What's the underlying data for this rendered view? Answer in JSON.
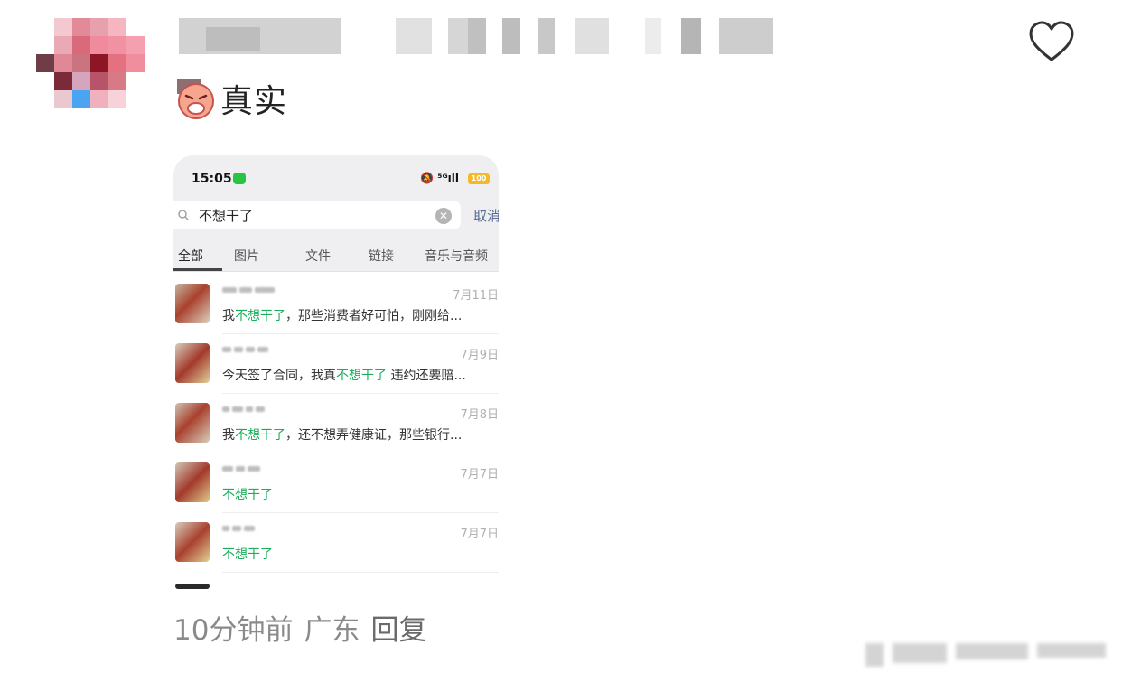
{
  "comment": {
    "text": "真实",
    "emoji_icon": "weary-face-icon"
  },
  "screenshot": {
    "status_time": "15:05",
    "status_icons": "🔕 ⁵ᴳıll",
    "battery": "100",
    "search": {
      "value": "不想干了",
      "cancel": "取消"
    },
    "tabs": [
      "全部",
      "图片",
      "文件",
      "链接",
      "音乐与音频"
    ],
    "results": [
      {
        "date": "7月11日",
        "pre": "我",
        "hl": "不想干了",
        "post": "，那些消费者好可怕，刚刚给..."
      },
      {
        "date": "7月9日",
        "pre": "今天签了合同，我真",
        "hl": "不想干了",
        "post": " 违约还要赔..."
      },
      {
        "date": "7月8日",
        "pre": "我",
        "hl": "不想干了",
        "post": "，还不想弄健康证，那些银行..."
      },
      {
        "date": "7月7日",
        "pre": "",
        "hl": "不想干了",
        "post": ""
      },
      {
        "date": "7月7日",
        "pre": "",
        "hl": "不想干了",
        "post": ""
      }
    ]
  },
  "footer": {
    "time": "10分钟前",
    "location": "广东",
    "reply": "回复"
  },
  "colors": {
    "highlight": "#1aad5a",
    "cancel_link": "#576b95"
  }
}
